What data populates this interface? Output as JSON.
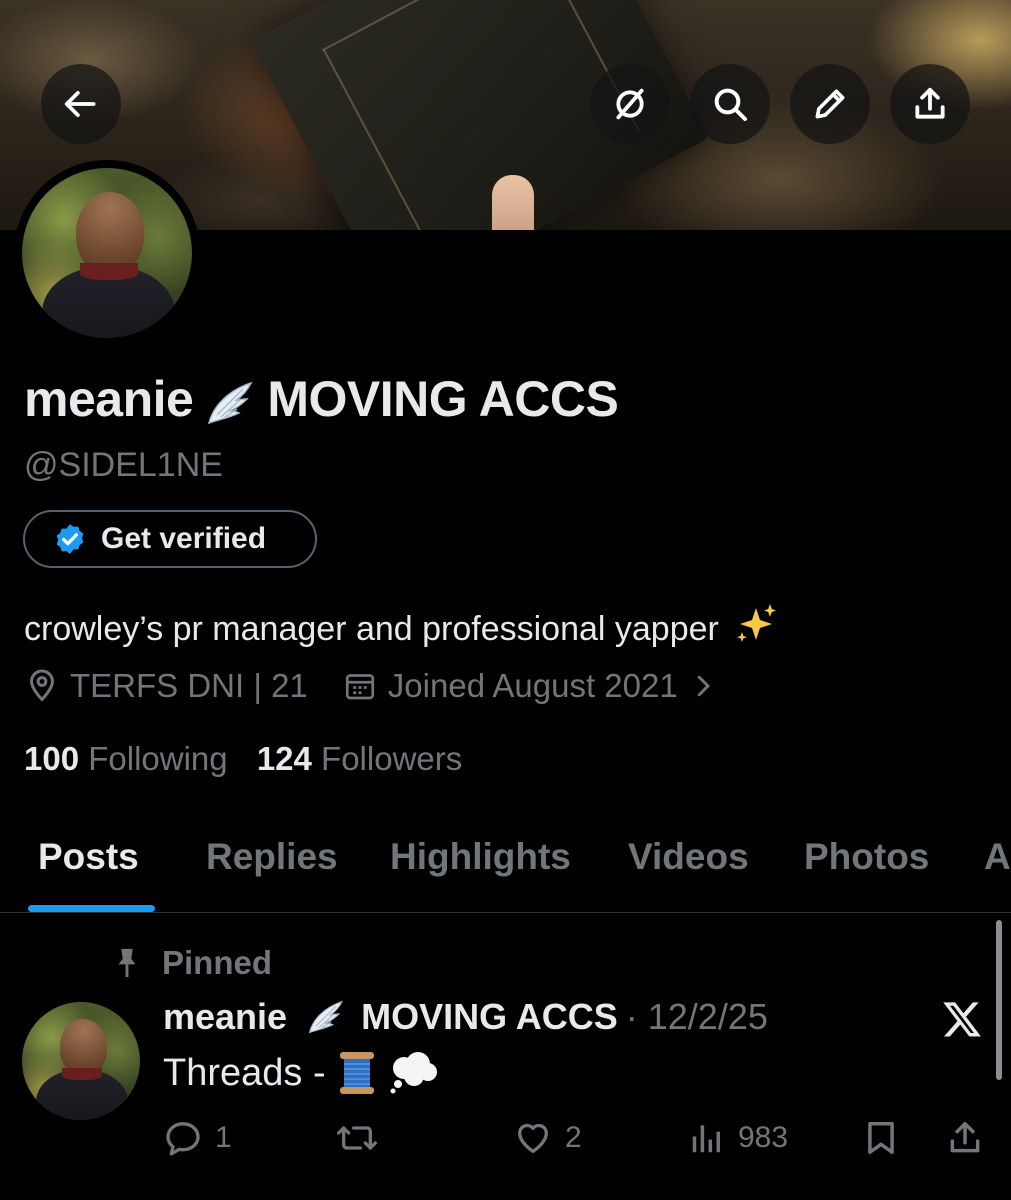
{
  "header": {
    "back_icon": "arrow-left-icon",
    "actions": [
      {
        "icon": "grok-icon"
      },
      {
        "icon": "search-icon"
      },
      {
        "icon": "pencil-icon"
      },
      {
        "icon": "share-icon"
      }
    ]
  },
  "profile": {
    "display_name_part1": "meanie",
    "display_name_emoji": "angel-wing-icon",
    "display_name_part2": "MOVING ACCS",
    "handle": "@SIDEL1NE",
    "verify_label": "Get verified",
    "bio_text": "crowley’s pr manager and professional yapper",
    "bio_emoji": "sparkles-icon",
    "location": "TERFS DNI | 21",
    "joined": "Joined August 2021",
    "following_count": "100",
    "following_label": "Following",
    "followers_count": "124",
    "followers_label": "Followers"
  },
  "tabs": [
    {
      "label": "Posts",
      "active": true
    },
    {
      "label": "Replies"
    },
    {
      "label": "Highlights"
    },
    {
      "label": "Videos"
    },
    {
      "label": "Photos"
    },
    {
      "label": "A"
    }
  ],
  "post": {
    "pinned_label": "Pinned",
    "author_part1": "meanie",
    "author_part2": "MOVING ACCS",
    "date": "· 12/2/25",
    "text": "Threads -",
    "text_emojis": [
      "spool-of-thread-icon",
      "thought-balloon-icon"
    ],
    "reply_count": "1",
    "repost_count": "",
    "like_count": "2",
    "view_count": "983"
  },
  "colors": {
    "background": "#000000",
    "text_primary": "#e7e9ea",
    "text_secondary": "#71767b",
    "accent": "#1d9bf0",
    "verified_badge": "#1d9bf0"
  }
}
